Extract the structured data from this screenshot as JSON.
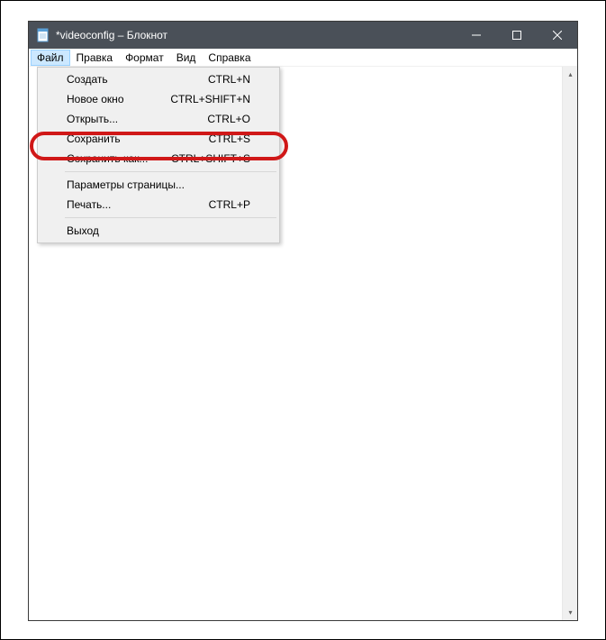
{
  "window": {
    "title": "*videoconfig – Блокнот"
  },
  "menubar": {
    "file": "Файл",
    "edit": "Правка",
    "format": "Формат",
    "view": "Вид",
    "help": "Справка"
  },
  "file_menu": {
    "items": [
      {
        "label": "Создать",
        "shortcut": "CTRL+N"
      },
      {
        "label": "Новое окно",
        "shortcut": "CTRL+SHIFT+N"
      },
      {
        "label": "Открыть...",
        "shortcut": "CTRL+O"
      },
      {
        "label": "Сохранить",
        "shortcut": "CTRL+S"
      },
      {
        "label": "Сохранить как...",
        "shortcut": "CTRL+SHIFT+S"
      }
    ],
    "items2": [
      {
        "label": "Параметры страницы...",
        "shortcut": ""
      },
      {
        "label": "Печать...",
        "shortcut": "CTRL+P"
      }
    ],
    "items3": [
      {
        "label": "Выход",
        "shortcut": ""
      }
    ]
  }
}
